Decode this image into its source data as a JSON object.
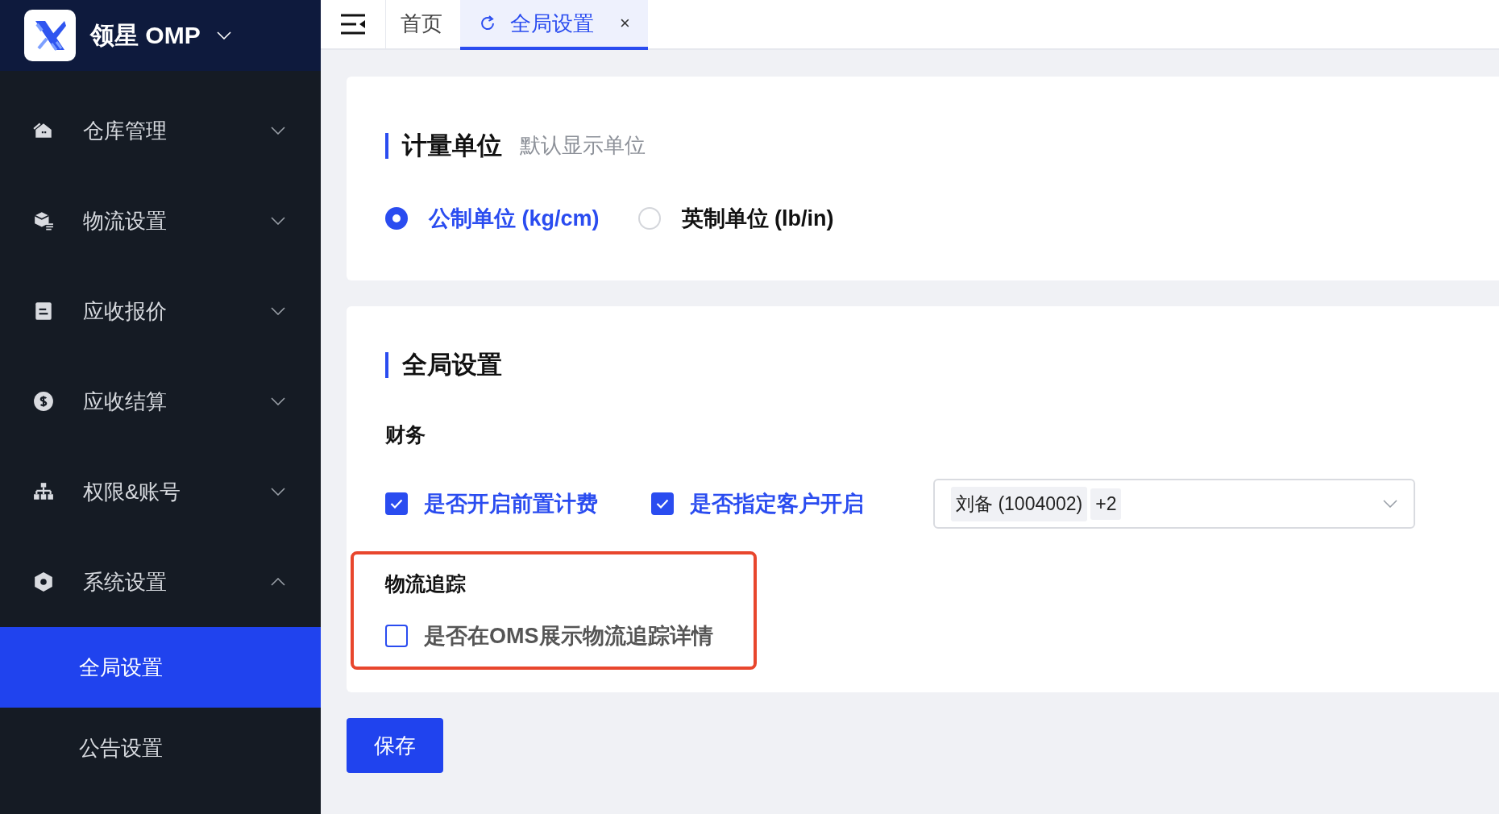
{
  "brand": {
    "name": "领星 OMP"
  },
  "sidebar": {
    "items": [
      {
        "label": "仓库管理",
        "expanded": false
      },
      {
        "label": "物流设置",
        "expanded": false
      },
      {
        "label": "应收报价",
        "expanded": false
      },
      {
        "label": "应收结算",
        "expanded": false
      },
      {
        "label": "权限&账号",
        "expanded": false
      },
      {
        "label": "系统设置",
        "expanded": true,
        "children": [
          {
            "label": "全局设置",
            "selected": true
          },
          {
            "label": "公告设置",
            "selected": false
          }
        ]
      }
    ]
  },
  "tabs": [
    {
      "label": "首页",
      "selected": false
    },
    {
      "label": "全局设置",
      "selected": true,
      "close": "×"
    }
  ],
  "unit_card": {
    "title": "计量单位",
    "subtitle": "默认显示单位",
    "options": [
      {
        "label": "公制单位 (kg/cm)",
        "selected": true
      },
      {
        "label": "英制单位 (lb/in)",
        "selected": false
      }
    ]
  },
  "global_card": {
    "title": "全局设置",
    "sections": [
      {
        "heading": "财务",
        "highlighted": false,
        "checkboxes": [
          {
            "label": "是否开启前置计费",
            "checked": true
          },
          {
            "label": "是否指定客户开启",
            "checked": true
          }
        ],
        "select": {
          "tags": [
            "刘备 (1004002)",
            "+2"
          ]
        }
      },
      {
        "heading": "物流追踪",
        "highlighted": true,
        "checkboxes": [
          {
            "label": "是否在OMS展示物流追踪详情",
            "checked": false
          }
        ]
      }
    ]
  },
  "save_button": "保存"
}
